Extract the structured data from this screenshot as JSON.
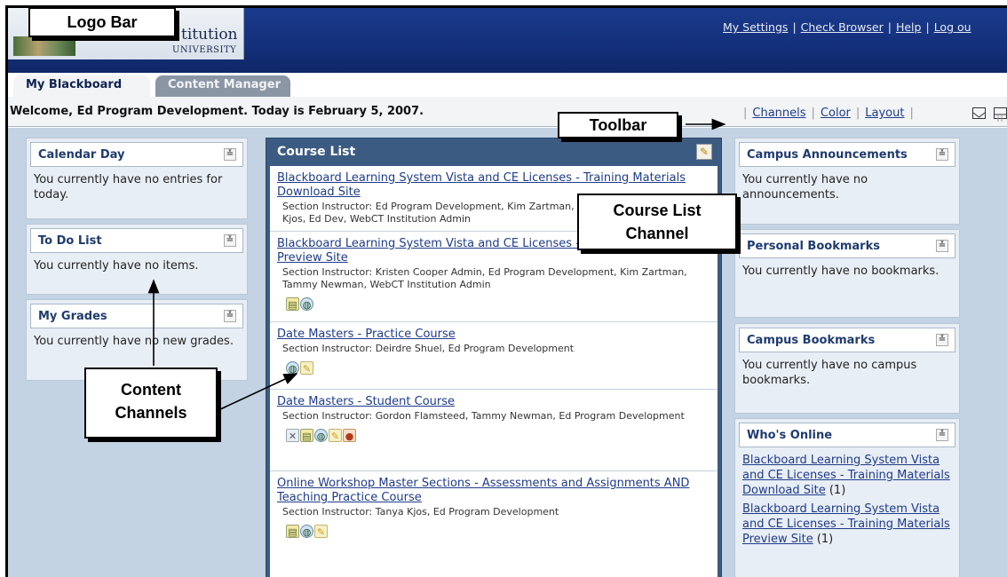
{
  "header": {
    "logo_text_line1": "titution",
    "logo_text_line2": "UNIVERSITY",
    "utility_links": [
      "My Settings",
      "Check Browser",
      "Help",
      "Log ou"
    ]
  },
  "tabs": [
    {
      "label": "My Blackboard",
      "active": true
    },
    {
      "label": "Content Manager",
      "active": false
    }
  ],
  "welcome_bar": {
    "welcome_text": "Welcome, Ed Program Development. Today is February 5, 2007.",
    "toolbar_links": [
      "Channels",
      "Color",
      "Layout"
    ],
    "toolbar_icons": [
      "envelope-icon",
      "calendar-icon"
    ]
  },
  "left_channels": [
    {
      "title": "Calendar Day",
      "body": "You currently have no entries for today."
    },
    {
      "title": "To Do List",
      "body": "You currently have no items."
    },
    {
      "title": "My Grades",
      "body": "You currently have no new grades."
    }
  ],
  "course_list": {
    "title": "Course List",
    "courses": [
      {
        "name": " Blackboard Learning System  Vista and CE Licenses - Training Materials Download Site",
        "instructors": "Section Instructor: Ed Program Development, Kim Zartman, Tammy Newman, Tanya Kjos, Ed Dev, WebCT Institution Admin",
        "icons": []
      },
      {
        "name": " Blackboard Learning System  Vista and CE Licenses - Training Materials Preview Site",
        "instructors": "Section Instructor: Kristen Cooper Admin, Ed Program Development, Kim Zartman, Tammy Newman, WebCT Institution Admin",
        "icons": [
          "doc",
          "globe"
        ]
      },
      {
        "name": " Date Masters - Practice Course",
        "instructors": "Section Instructor: Deirdre Shuel, Ed Program Development",
        "icons": [
          "globe",
          "pencil"
        ]
      },
      {
        "name": " Date Masters - Student Course",
        "instructors": "Section Instructor: Gordon Flamsteed, Tammy Newman, Ed Program Development",
        "icons": [
          "tools",
          "doc",
          "globe",
          "pencil",
          "apple"
        ]
      },
      {
        "name": " Online Workshop Master Sections - Assessments and Assignments AND Teaching Practice Course",
        "instructors": "Section Instructor: Tanya Kjos, Ed Program Development",
        "icons": [
          "doc",
          "globe",
          "pencil"
        ]
      }
    ]
  },
  "right_channels": {
    "campus_announcements": {
      "title": "Campus Announcements",
      "body": "You currently have no announcements."
    },
    "personal_bookmarks": {
      "title": "Personal Bookmarks",
      "body": "You currently have no bookmarks."
    },
    "campus_bookmarks": {
      "title": "Campus Bookmarks",
      "body": "You currently have no campus bookmarks."
    },
    "whos_online": {
      "title": "Who's Online",
      "entries": [
        {
          "name": " Blackboard Learning System  Vista and CE Licenses - Training Materials Download Site",
          "count": "(1)"
        },
        {
          "name": " Blackboard Learning System  Vista and CE Licenses - Training Materials Preview Site",
          "count": "(1)"
        }
      ]
    }
  },
  "callouts": {
    "logo_bar": "Logo Bar",
    "toolbar": "Toolbar",
    "course_list_channel": [
      "Course List",
      "Channel"
    ],
    "content_channels": [
      "Content",
      "Channels"
    ]
  },
  "colors": {
    "header_blue": "#14307a",
    "content_background": "#c3d3e3",
    "course_list_header": "#3c5b82",
    "link_blue": "#1f3b8a"
  }
}
